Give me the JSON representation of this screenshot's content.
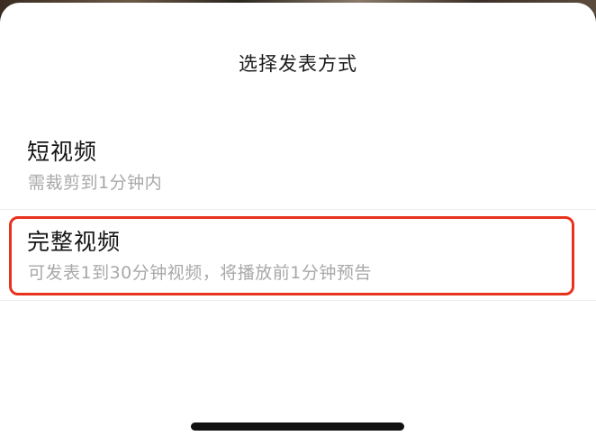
{
  "sheet": {
    "title": "选择发表方式"
  },
  "options": [
    {
      "title": "短视频",
      "subtitle": "需裁剪到1分钟内"
    },
    {
      "title": "完整视频",
      "subtitle": "可发表1到30分钟视频，将播放前1分钟预告"
    }
  ],
  "annotation": {
    "highlight_color": "#e8321e"
  }
}
